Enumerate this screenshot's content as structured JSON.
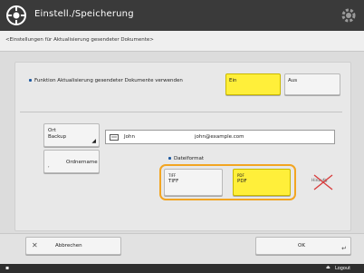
{
  "titlebar": {
    "title": "Einstell./Speicherung"
  },
  "breadcrumb": "<Einstellungen für Aktualisierung gesendeter Dokumente>",
  "function_row": {
    "label": "Funktion Aktualisierung gesendeter Dokumente verwenden",
    "on_label": "Ein",
    "off_label": "Aus",
    "selected": "Ein"
  },
  "destination": {
    "button_label_line1": "Ort",
    "button_label_line2": "Backup",
    "address_name": "John",
    "address_email": "john@example.com"
  },
  "folder_name": {
    "label": "Ordnername"
  },
  "file_format": {
    "heading": "Dateiformat",
    "options": [
      {
        "tag": "TIFF",
        "label": "TIFF"
      },
      {
        "tag": "PDF",
        "label": "PDF"
      }
    ],
    "selected": "PDF",
    "disabled_label": "Hinzufg."
  },
  "footer": {
    "cancel_label": "Abbrechen",
    "ok_label": "OK"
  },
  "statusbar": {
    "right_text": "Logout"
  },
  "colors": {
    "selected": "#ffef3a",
    "highlight": "#f2a522",
    "accent": "#1e5aa0"
  }
}
